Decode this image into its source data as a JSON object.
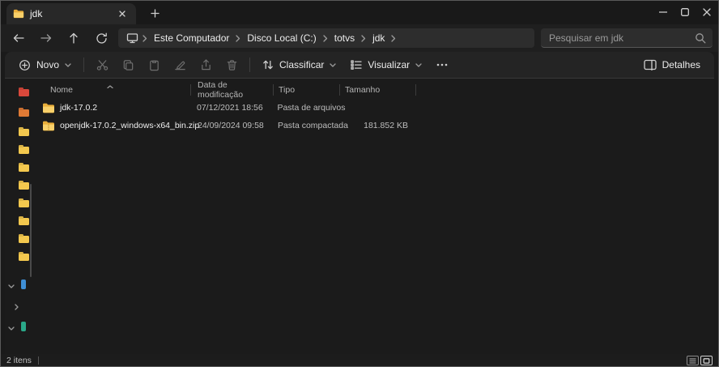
{
  "titlebar": {
    "tab_title": "jdk"
  },
  "nav": {
    "breadcrumb": [
      "Este Computador",
      "Disco Local (C:)",
      "totvs",
      "jdk"
    ],
    "search_placeholder": "Pesquisar em jdk"
  },
  "toolbar": {
    "new_label": "Novo",
    "sort_label": "Classificar",
    "view_label": "Visualizar",
    "details_label": "Detalhes"
  },
  "list": {
    "columns": {
      "name": "Nome",
      "modified": "Data de modificação",
      "type": "Tipo",
      "size": "Tamanho"
    },
    "rows": [
      {
        "name": "jdk-17.0.2",
        "modified": "07/12/2021 18:56",
        "type": "Pasta de arquivos",
        "size": ""
      },
      {
        "name": "openjdk-17.0.2_windows-x64_bin.zip",
        "modified": "24/09/2024 09:58",
        "type": "Pasta compactada",
        "size": "181.852 KB"
      }
    ]
  },
  "statusbar": {
    "items_text": "2 itens"
  },
  "icons": {
    "sidebar_pinned": [
      "folder-red",
      "folder-orange",
      "folder-yellow",
      "folder-yellow",
      "folder-yellow",
      "folder-yellow",
      "folder-yellow",
      "folder-yellow",
      "folder-yellow",
      "folder-yellow",
      "drive-blue",
      "drive-teal"
    ]
  },
  "colors": {
    "folder_yellow": "#f3c84e",
    "window_bg": "#1a1a1a",
    "card_bg": "#1b1b1b"
  }
}
